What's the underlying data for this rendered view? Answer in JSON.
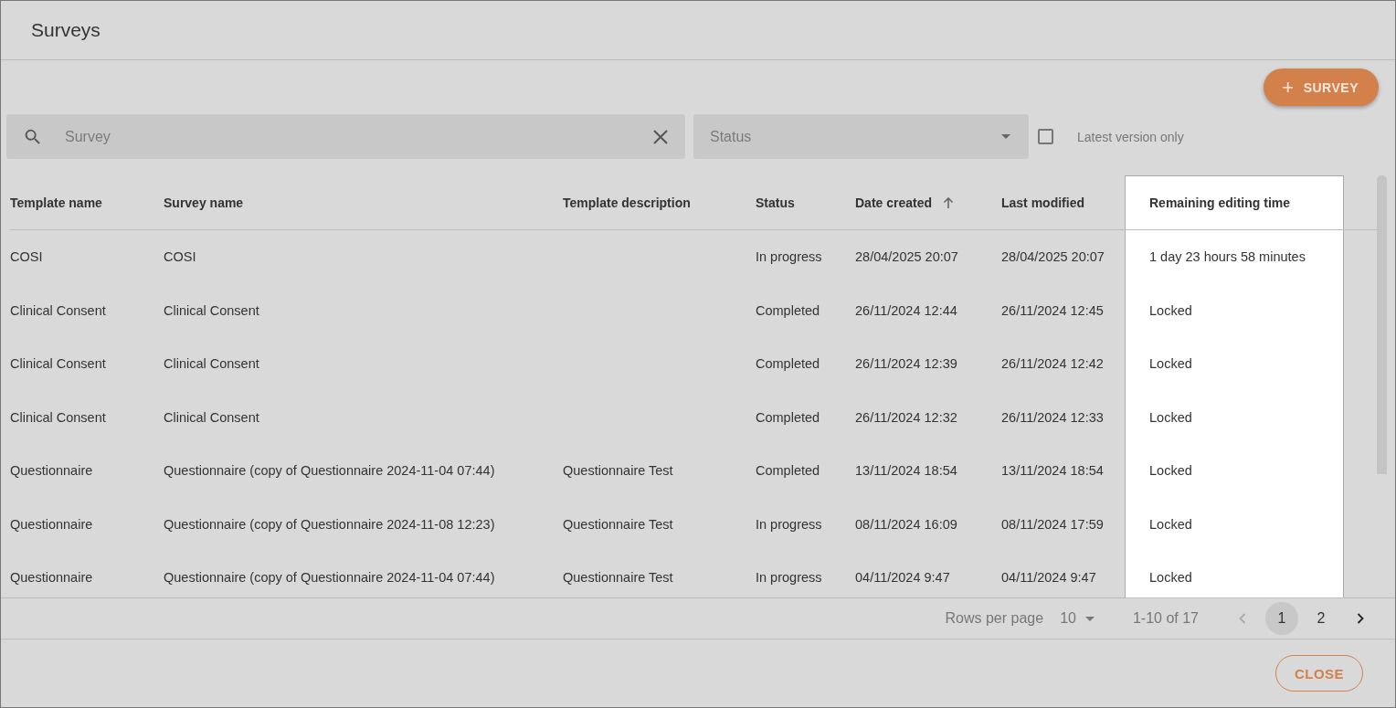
{
  "dialog": {
    "title": "Surveys"
  },
  "add_button": {
    "icon": "+",
    "label": "SURVEY"
  },
  "search": {
    "placeholder": "Survey"
  },
  "status_filter": {
    "placeholder": "Status"
  },
  "latest_version_only": {
    "label": "Latest version only",
    "checked": false
  },
  "table": {
    "columns": [
      {
        "label": "Template name",
        "sorted": false,
        "highlighted": false
      },
      {
        "label": "Survey name",
        "sorted": false,
        "highlighted": false
      },
      {
        "label": "Template description",
        "sorted": false,
        "highlighted": false
      },
      {
        "label": "Status",
        "sorted": false,
        "highlighted": false
      },
      {
        "label": "Date created",
        "sorted": true,
        "highlighted": false
      },
      {
        "label": "Last modified",
        "sorted": false,
        "highlighted": false
      },
      {
        "label": "Remaining editing time",
        "sorted": false,
        "highlighted": true
      }
    ],
    "rows": [
      [
        "COSI",
        "COSI",
        "",
        "In progress",
        "28/04/2025 20:07",
        "28/04/2025 20:07",
        "1 day 23 hours 58 minutes"
      ],
      [
        "Clinical Consent",
        "Clinical Consent",
        "",
        "Completed",
        "26/11/2024 12:44",
        "26/11/2024 12:45",
        "Locked"
      ],
      [
        "Clinical Consent",
        "Clinical Consent",
        "",
        "Completed",
        "26/11/2024 12:39",
        "26/11/2024 12:42",
        "Locked"
      ],
      [
        "Clinical Consent",
        "Clinical Consent",
        "",
        "Completed",
        "26/11/2024 12:32",
        "26/11/2024 12:33",
        "Locked"
      ],
      [
        "Questionnaire",
        "Questionnaire (copy of Questionnaire 2024-11-04 07:44)",
        "Questionnaire Test",
        "Completed",
        "13/11/2024 18:54",
        "13/11/2024 18:54",
        "Locked"
      ],
      [
        "Questionnaire",
        "Questionnaire (copy of Questionnaire 2024-11-08 12:23)",
        "Questionnaire Test",
        "In progress",
        "08/11/2024 16:09",
        "08/11/2024 17:59",
        "Locked"
      ],
      [
        "Questionnaire",
        "Questionnaire (copy of Questionnaire 2024-11-04 07:44)",
        "Questionnaire Test",
        "In progress",
        "04/11/2024 9:47",
        "04/11/2024 9:47",
        "Locked"
      ]
    ]
  },
  "pagination": {
    "rows_per_page_label": "Rows per page",
    "rows_per_page": "10",
    "range": "1-10 of 17",
    "previous_disabled": true,
    "next_disabled": false,
    "pages": [
      {
        "label": "1",
        "selected": true
      },
      {
        "label": "2",
        "selected": false
      }
    ]
  },
  "close_button": {
    "label": "CLOSE"
  }
}
